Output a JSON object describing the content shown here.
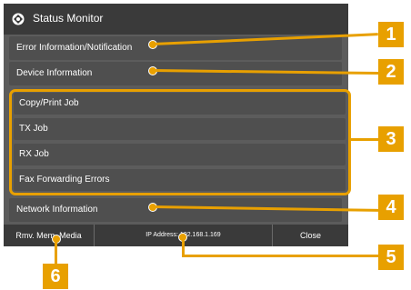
{
  "header": {
    "title": "Status Monitor",
    "icon": "status-monitor-icon"
  },
  "menu": {
    "error_info": "Error Information/Notification",
    "device_info": "Device Information",
    "job_group": [
      "Copy/Print Job",
      "TX Job",
      "RX Job",
      "Fax Forwarding Errors"
    ],
    "network_info": "Network Information"
  },
  "footer": {
    "media_label": "Rmv. Mem. Media",
    "ip_label": "IP Address:",
    "ip_value": "192.168.1.169",
    "close_label": "Close"
  },
  "callouts": [
    "1",
    "2",
    "3",
    "4",
    "5",
    "6"
  ],
  "colors": {
    "accent": "#e8a000",
    "panel": "#5c5c5c",
    "titlebar": "#3a3a3a"
  }
}
